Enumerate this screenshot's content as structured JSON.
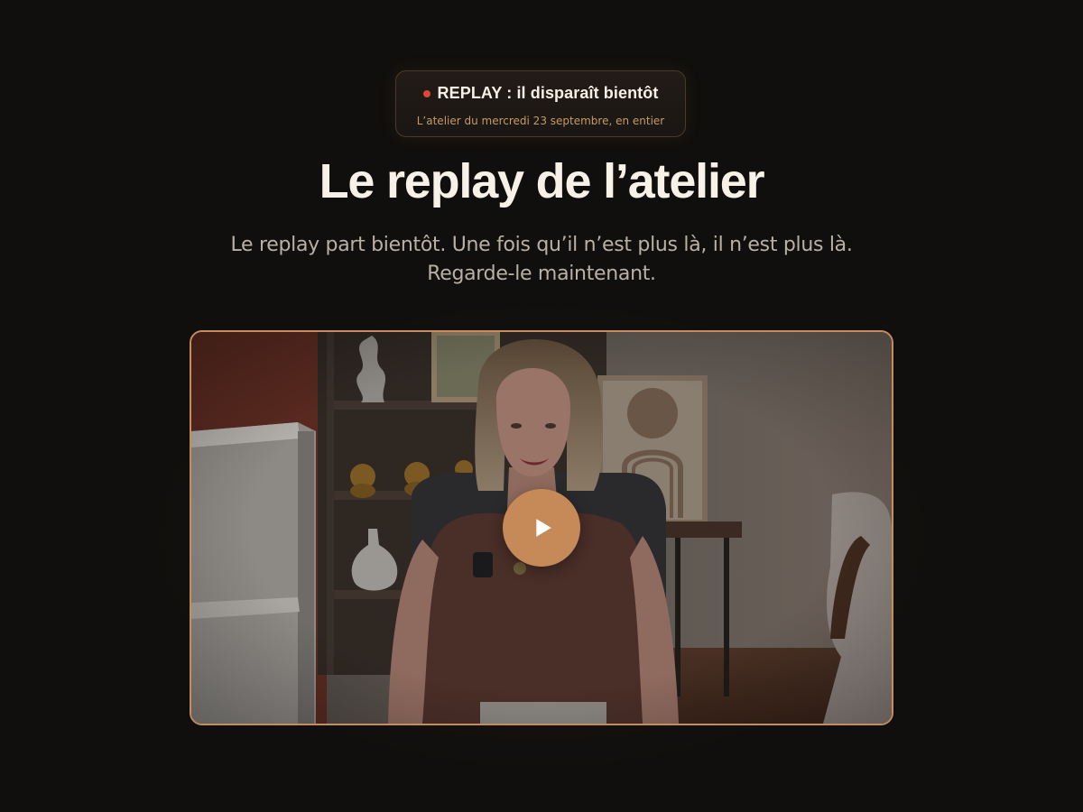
{
  "badge": {
    "title": "REPLAY : il disparaît bientôt",
    "subtitle": "L’atelier du mercredi 23 septembre, en entier"
  },
  "main": {
    "title": "Le replay de l’atelier",
    "subtitle_lines": [
      "Le replay part bientôt. Une fois qu’il n’est plus là, il n’est plus là.",
      "Regarde-le maintenant."
    ]
  },
  "video": {
    "play_icon": "play-icon",
    "thumbnail": "presenter-video-thumbnail"
  },
  "colors": {
    "background": "#110f0d",
    "accent": "#c68a58",
    "live_dot": "#e0443a",
    "badge_subtitle": "#c79a68"
  }
}
